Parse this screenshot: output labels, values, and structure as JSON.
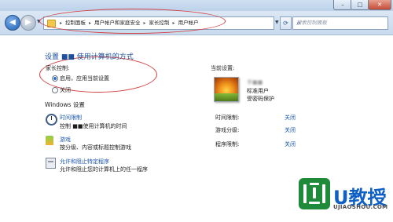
{
  "window": {
    "minimize_glyph": "–",
    "maximize_glyph": "□",
    "close_glyph": "✕"
  },
  "nav": {
    "breadcrumbs": [
      "控制面板",
      "用户帐户和家庭安全",
      "家长控制",
      "用户帐户"
    ],
    "separator": "▸",
    "search_placeholder": "搜索控制面板"
  },
  "main": {
    "heading": "设置 ■■ 使用计算机的方式",
    "parental_control_label": "家长控制:",
    "options": [
      {
        "label": "启用，应用当前设置",
        "selected": true
      },
      {
        "label": "关闭",
        "selected": false
      }
    ],
    "windows_settings_label": "Windows 设置",
    "settings": [
      {
        "title": "时间限制",
        "description": "控制 ■■使用计算机的时间",
        "icon": "clock-icon"
      },
      {
        "title": "游戏",
        "description": "按分级、内容或标题控制游戏",
        "icon": "game-controller-icon"
      },
      {
        "title": "允许和阻止特定程序",
        "description": "允许和阻止您的计算机上的任一程序",
        "icon": "program-window-icon"
      }
    ]
  },
  "current": {
    "label": "当前设置:",
    "user_name": "李■■",
    "user_type": "标准用户",
    "protection": "受密码保护",
    "rows": [
      {
        "label": "时间限制:",
        "value": "关闭"
      },
      {
        "label": "游戏分级:",
        "value": "关闭"
      },
      {
        "label": "程序限制:",
        "value": "关闭"
      }
    ]
  },
  "watermark": {
    "brand": "U教授",
    "site": "UJIAOSHOU.COM"
  },
  "colors": {
    "link": "#1a56b0",
    "heading": "#1c4f9c",
    "annotation": "#d24040",
    "logo_green": "#1e8a3a",
    "logo_blue": "#0e5fc6"
  }
}
